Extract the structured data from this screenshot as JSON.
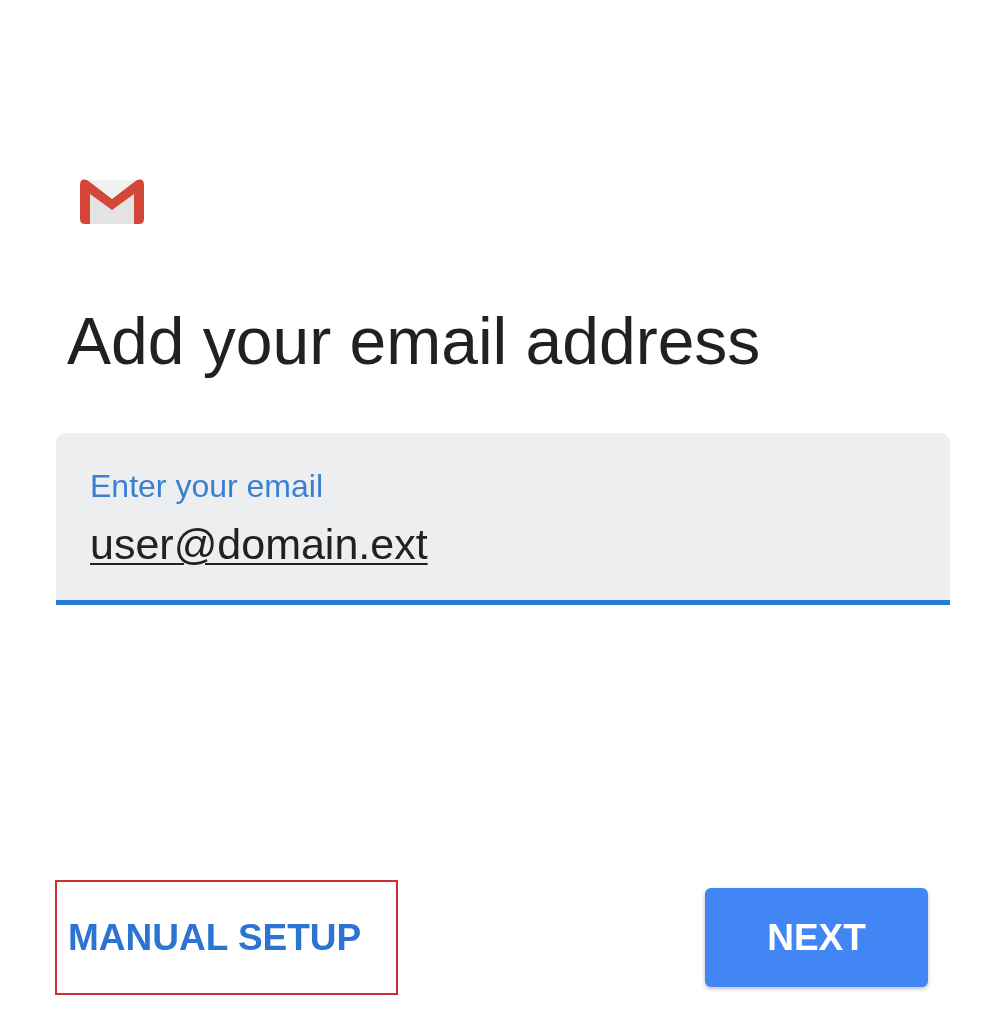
{
  "title": "Add your email address",
  "email_field": {
    "label": "Enter your email",
    "value": "user@domain.ext",
    "focused": true
  },
  "buttons": [
    {
      "label": "MANUAL SETUP",
      "kind": "text",
      "highlighted": true
    },
    {
      "label": "NEXT",
      "kind": "filled",
      "highlighted": false
    }
  ]
}
